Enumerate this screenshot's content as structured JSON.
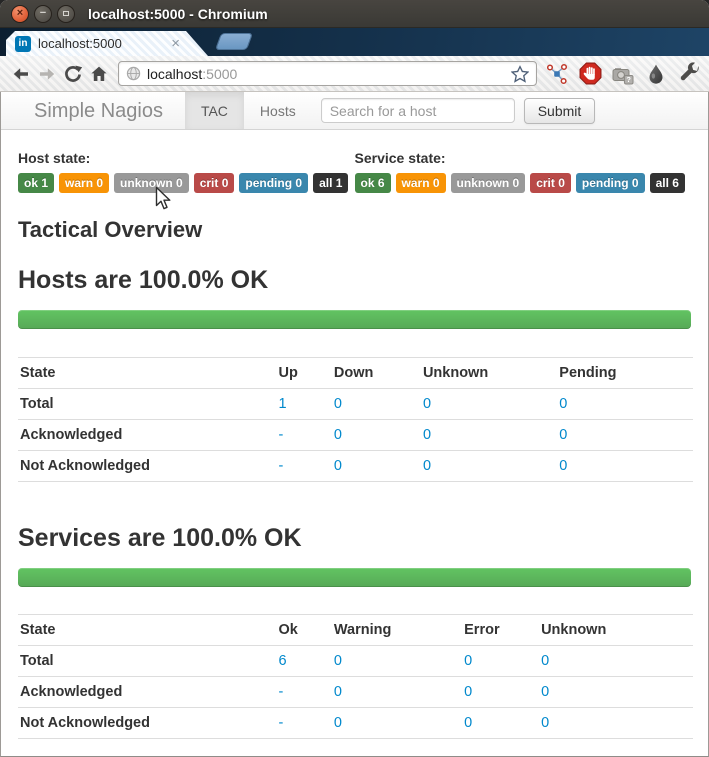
{
  "window": {
    "title": "localhost:5000 - Chromium"
  },
  "browser": {
    "tab": {
      "favicon_text": "in",
      "title": "localhost:5000",
      "close_glyph": "×"
    },
    "urlbar": {
      "host": "localhost",
      "port": ":5000"
    },
    "controls": {
      "close_glyph": "×",
      "minimize_glyph": "−"
    }
  },
  "navbar": {
    "brand": "Simple Nagios",
    "items": [
      {
        "label": "TAC",
        "active": true
      },
      {
        "label": "Hosts",
        "active": false
      }
    ],
    "search_placeholder": "Search for a host",
    "submit_label": "Submit"
  },
  "host_state": {
    "title": "Host state:",
    "badges": [
      "ok 1",
      "warn 0",
      "unknown 0",
      "crit 0",
      "pending 0",
      "all 1"
    ]
  },
  "service_state": {
    "title": "Service state:",
    "badges": [
      "ok 6",
      "warn 0",
      "unknown 0",
      "crit 0",
      "pending 0",
      "all 6"
    ]
  },
  "overview": {
    "title": "Tactical Overview"
  },
  "hosts_section": {
    "heading": "Hosts are 100.0% OK",
    "progress_percent": 100,
    "table": {
      "headers": [
        "State",
        "Up",
        "Down",
        "Unknown",
        "Pending"
      ],
      "rows": [
        [
          "Total",
          "1",
          "0",
          "0",
          "0"
        ],
        [
          "Acknowledged",
          "-",
          "0",
          "0",
          "0"
        ],
        [
          "Not Acknowledged",
          "-",
          "0",
          "0",
          "0"
        ]
      ]
    }
  },
  "services_section": {
    "heading": "Services are 100.0% OK",
    "progress_percent": 100,
    "table": {
      "headers": [
        "State",
        "Ok",
        "Warning",
        "Error",
        "Unknown"
      ],
      "rows": [
        [
          "Total",
          "6",
          "0",
          "0",
          "0"
        ],
        [
          "Acknowledged",
          "-",
          "0",
          "0",
          "0"
        ],
        [
          "Not Acknowledged",
          "-",
          "0",
          "0",
          "0"
        ]
      ]
    }
  },
  "colors": {
    "badge_ok": "#468847",
    "badge_warn": "#f89406",
    "badge_unknown": "#999999",
    "badge_crit": "#b94a48",
    "badge_pending": "#3a87ad",
    "badge_all": "#333333",
    "link": "#0088cc",
    "progress_green": "#57a957",
    "titlebar": "#3a3935",
    "tabstrip": "#15324d"
  }
}
